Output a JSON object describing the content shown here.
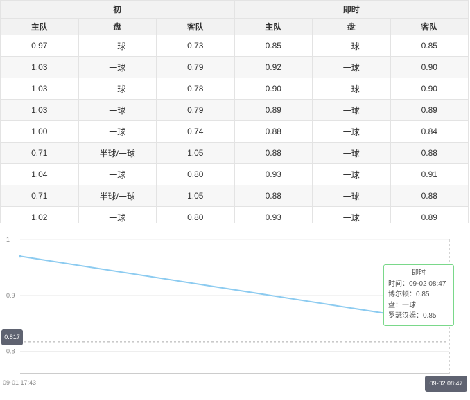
{
  "table": {
    "group_headers": [
      "初",
      "即时"
    ],
    "sub_headers": [
      "主队",
      "盘",
      "客队",
      "主队",
      "盘",
      "客队"
    ],
    "rows": [
      [
        "0.97",
        "一球",
        "0.73",
        "0.85",
        "一球",
        "0.85"
      ],
      [
        "1.03",
        "一球",
        "0.79",
        "0.92",
        "一球",
        "0.90"
      ],
      [
        "1.03",
        "一球",
        "0.78",
        "0.90",
        "一球",
        "0.90"
      ],
      [
        "1.03",
        "一球",
        "0.79",
        "0.89",
        "一球",
        "0.89"
      ],
      [
        "1.00",
        "一球",
        "0.74",
        "0.88",
        "一球",
        "0.84"
      ],
      [
        "0.71",
        "半球/一球",
        "1.05",
        "0.88",
        "一球",
        "0.88"
      ],
      [
        "1.04",
        "一球",
        "0.80",
        "0.93",
        "一球",
        "0.91"
      ],
      [
        "0.71",
        "半球/一球",
        "1.05",
        "0.88",
        "一球",
        "0.88"
      ],
      [
        "1.02",
        "一球",
        "0.80",
        "0.93",
        "一球",
        "0.89"
      ]
    ]
  },
  "chart_data": {
    "type": "line",
    "x": [
      "09-01 17:43",
      "09-02 08:47"
    ],
    "series": [
      {
        "values": [
          0.97,
          0.85
        ]
      }
    ],
    "yticks": [
      "1",
      "0.9",
      "0.8"
    ],
    "ylim": [
      0.76,
      1.0
    ],
    "grid": true,
    "line_color": "#8ccbf0",
    "x_labels": {
      "start": "09-01 17:43",
      "end": "09-02 08:47"
    },
    "pointer": {
      "y_label": "0.817",
      "x_label": "09-02 08:47"
    },
    "tooltip": {
      "title": "即时",
      "lines": [
        "时间：09-02 08:47",
        "博尔顿：0.85",
        "盘：一球",
        "罗瑟汉姆：0.85"
      ],
      "border_color": "#7ad88a"
    }
  }
}
